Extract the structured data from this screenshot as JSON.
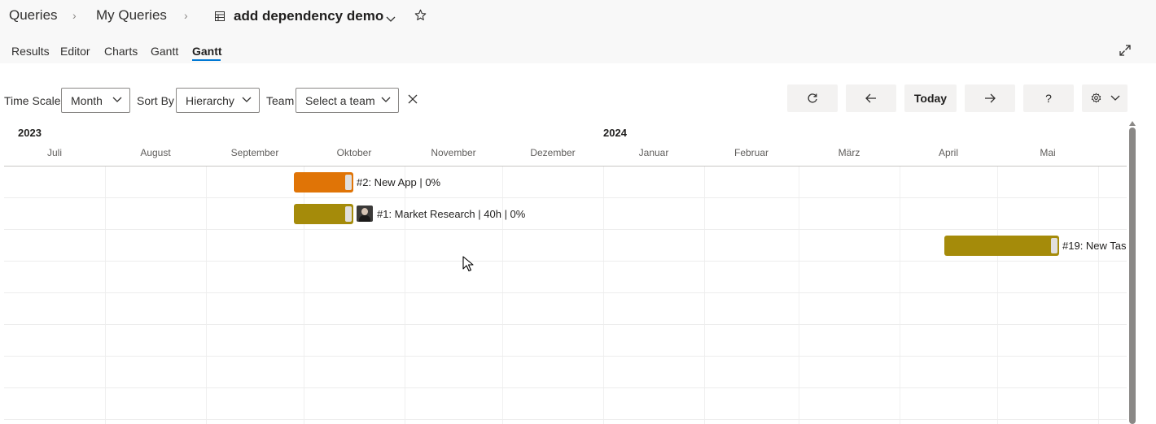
{
  "breadcrumb": {
    "items": [
      "Queries",
      "My Queries"
    ],
    "separator": "›",
    "query_title": "add dependency demo"
  },
  "tabs": [
    "Results",
    "Editor",
    "Charts",
    "Gantt",
    "Gantt"
  ],
  "active_tab_index": 4,
  "toolbar": {
    "time_scale_label": "Time Scale",
    "time_scale_value": "Month",
    "sort_by_label": "Sort By",
    "sort_by_value": "Hierarchy",
    "team_label": "Team",
    "team_value": "Select a team",
    "today_label": "Today",
    "help_label": "?"
  },
  "timeline": {
    "years": [
      "2023",
      "2024"
    ],
    "months": [
      "Juli",
      "August",
      "September",
      "Oktober",
      "November",
      "Dezember",
      "Januar",
      "Februar",
      "März",
      "April",
      "Mai"
    ]
  },
  "tasks": [
    {
      "label": "#2: New App | 0%",
      "color": "#e07406"
    },
    {
      "label": "#1: Market Research | 40h | 0%",
      "color": "#a58b0a",
      "has_avatar": true
    },
    {
      "label": "#19: New Tas",
      "color": "#a58b0a"
    }
  ],
  "icons": {
    "title": "table-icon",
    "favorite": "star-icon",
    "expand": "expand-icon",
    "refresh": "refresh-icon",
    "prev": "arrow-left-icon",
    "next": "arrow-right-icon",
    "settings": "gear-icon",
    "clear": "close-icon"
  }
}
